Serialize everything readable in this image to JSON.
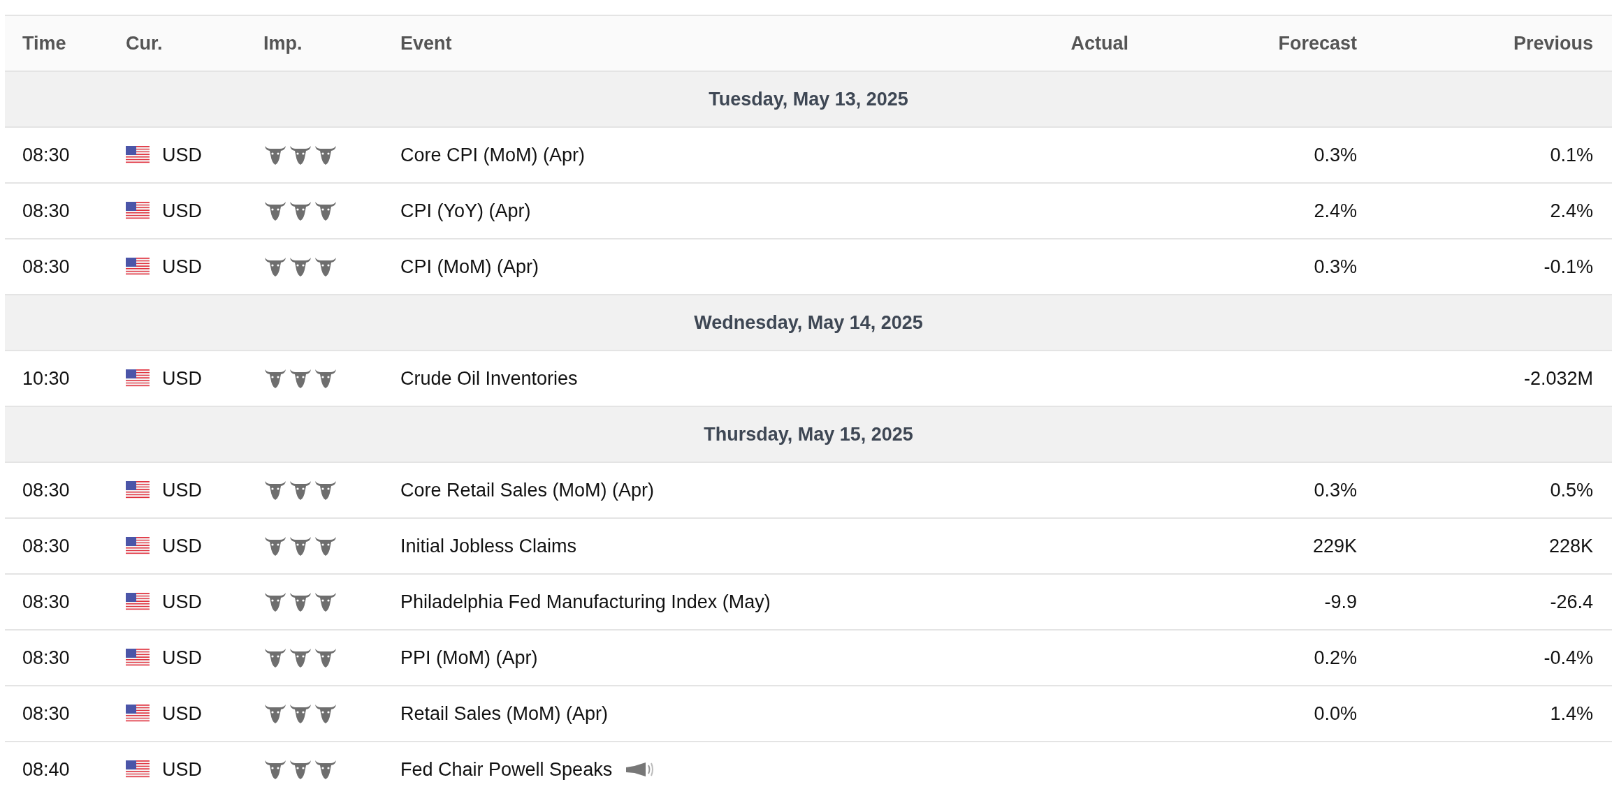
{
  "columns": [
    "Time",
    "Cur.",
    "Imp.",
    "Event",
    "Actual",
    "Forecast",
    "Previous"
  ],
  "days": [
    {
      "date": "Tuesday, May 13, 2025",
      "events": [
        {
          "time": "08:30",
          "currency": "USD",
          "stars": 3,
          "event": "Core CPI (MoM) (Apr)",
          "forecast": "0.3%",
          "previous": "0.1%",
          "speech": false
        },
        {
          "time": "08:30",
          "currency": "USD",
          "stars": 3,
          "event": "CPI (YoY) (Apr)",
          "forecast": "2.4%",
          "previous": "2.4%",
          "speech": false
        },
        {
          "time": "08:30",
          "currency": "USD",
          "stars": 3,
          "event": "CPI (MoM) (Apr)",
          "forecast": "0.3%",
          "previous": "-0.1%",
          "speech": false
        }
      ]
    },
    {
      "date": "Wednesday, May 14, 2025",
      "events": [
        {
          "time": "10:30",
          "currency": "USD",
          "stars": 3,
          "event": "Crude Oil Inventories",
          "previous": "-2.032M",
          "speech": false
        }
      ]
    },
    {
      "date": "Thursday, May 15, 2025",
      "events": [
        {
          "time": "08:30",
          "currency": "USD",
          "stars": 3,
          "event": "Core Retail Sales (MoM) (Apr)",
          "forecast": "0.3%",
          "previous": "0.5%",
          "speech": false
        },
        {
          "time": "08:30",
          "currency": "USD",
          "stars": 3,
          "event": "Initial Jobless Claims",
          "forecast": "229K",
          "previous": "228K",
          "speech": false
        },
        {
          "time": "08:30",
          "currency": "USD",
          "stars": 3,
          "event": "Philadelphia Fed Manufacturing Index (May)",
          "forecast": "-9.9",
          "previous": "-26.4",
          "speech": false
        },
        {
          "time": "08:30",
          "currency": "USD",
          "stars": 3,
          "event": "PPI (MoM) (Apr)",
          "forecast": "0.2%",
          "previous": "-0.4%",
          "speech": false
        },
        {
          "time": "08:30",
          "currency": "USD",
          "stars": 3,
          "event": "Retail Sales (MoM) (Apr)",
          "forecast": "0.0%",
          "previous": "1.4%",
          "speech": false
        },
        {
          "time": "08:40",
          "currency": "USD",
          "stars": 3,
          "event": "Fed Chair Powell Speaks",
          "speech": true
        }
      ]
    }
  ]
}
